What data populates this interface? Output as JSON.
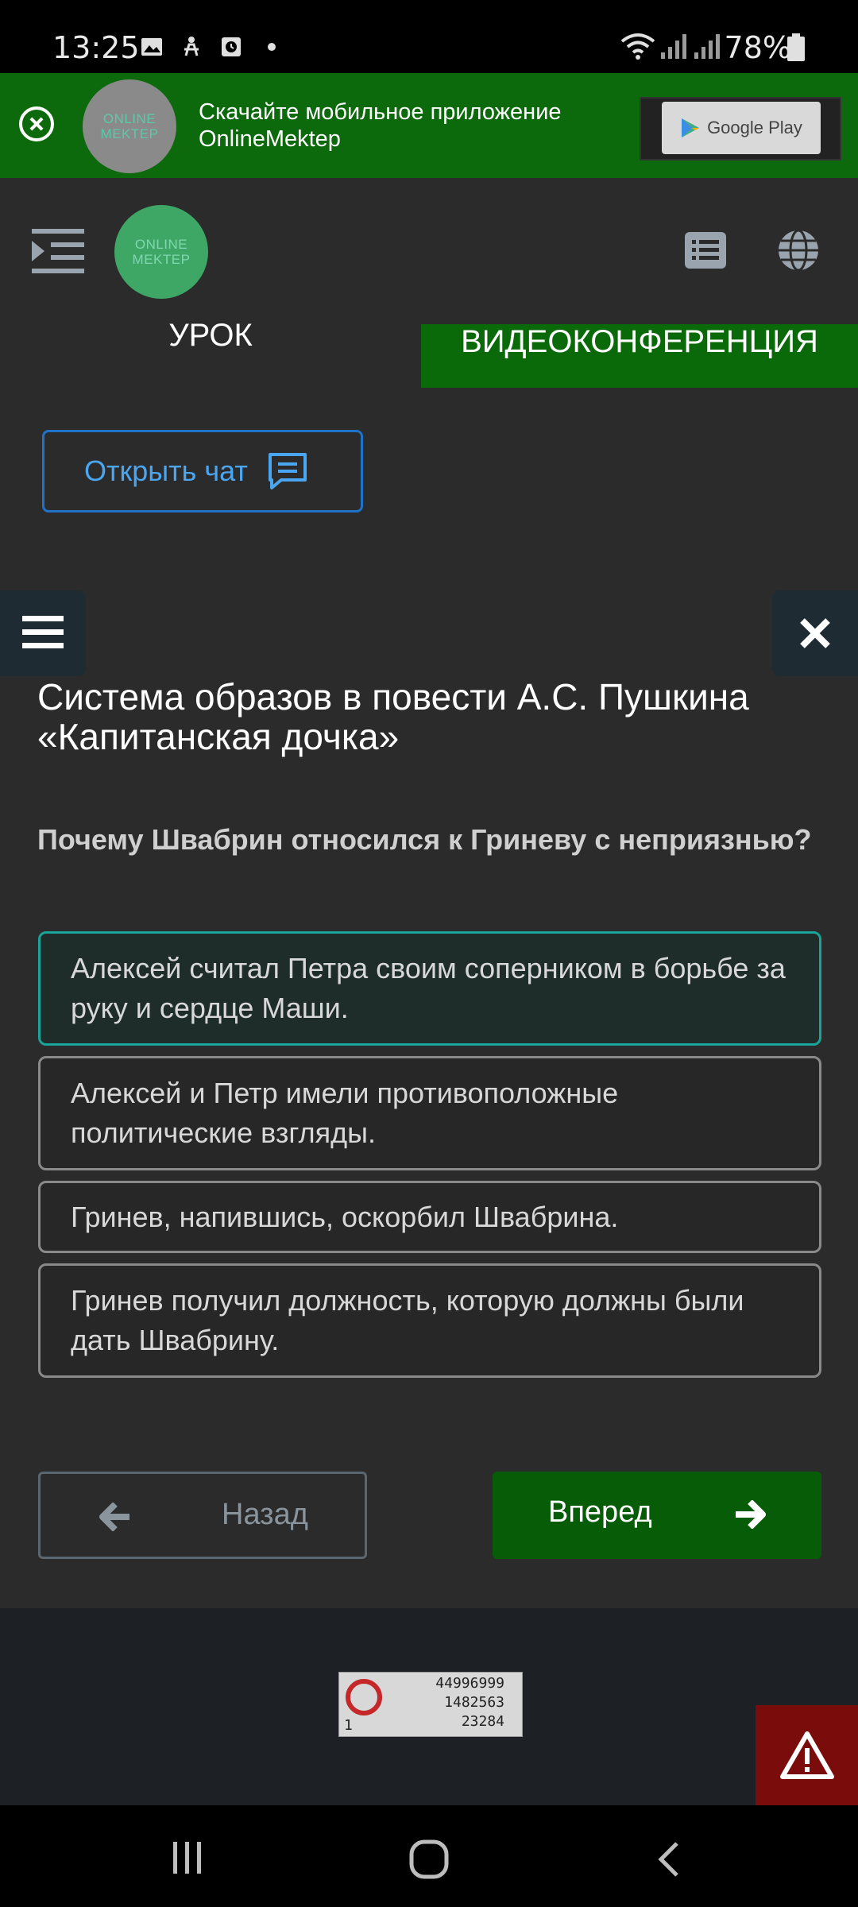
{
  "status_bar": {
    "time": "13:25",
    "battery": "78%",
    "icons": [
      "image-icon",
      "figure-icon",
      "alarm-icon",
      "dot-icon",
      "wifi-icon",
      "signal-icon",
      "signal-icon",
      "battery-icon"
    ]
  },
  "banner": {
    "line1": "Скачайте мобильное приложение",
    "line2": "OnlineMektep",
    "logo_line1": "ONLINE",
    "logo_line2": "MEKTEP",
    "store_label": "Google Play"
  },
  "header": {
    "logo_line1": "ONLINE",
    "logo_line2": "MEKTEP",
    "tabs": [
      {
        "label": "УРОК",
        "active": false
      },
      {
        "label": "ВИДЕОКОНФЕРЕНЦИЯ",
        "active": true
      }
    ]
  },
  "chat": {
    "open_label": "Открыть чат"
  },
  "content": {
    "lesson_title": "Система образов в повести А.С. Пушкина «Капитанская дочка»",
    "question": "Почему Швабрин относился к Гриневу с неприязнью?",
    "answers": [
      {
        "text": "Алексей считал Петра своим соперником в борьбе за руку и сердце Маши.",
        "selected": true
      },
      {
        "text": "Алексей и Петр имели противоположные политические взгляды.",
        "selected": false
      },
      {
        "text": "Гринев, напившись, оскорбил Швабрина.",
        "selected": false
      },
      {
        "text": "Гринев получил должность, которую должны были дать Швабрину.",
        "selected": false
      }
    ]
  },
  "navigation": {
    "back_label": "Назад",
    "forward_label": "Вперед"
  },
  "footer": {
    "counter_values": [
      "44996999",
      "1482563",
      "23284"
    ],
    "counter_index": "1"
  },
  "colors": {
    "accent_green": "#0a6a0a",
    "selected_border": "#1aa39a",
    "chat_blue": "#1e72c8",
    "alert_red": "#7a0c0c"
  }
}
